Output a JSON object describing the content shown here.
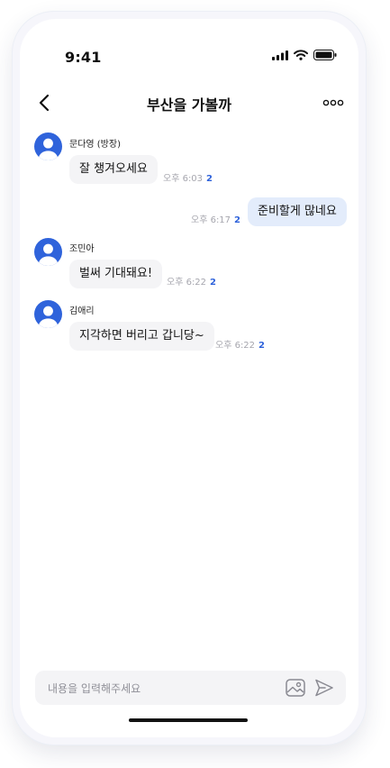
{
  "status_bar": {
    "time": "9:41"
  },
  "header": {
    "title": "부산을 가볼까"
  },
  "messages": [
    {
      "sender": "문다영 (방장)",
      "text": "잘 챙겨오세요",
      "time": "오후 6:03",
      "unread": "2"
    },
    {
      "sender": "",
      "text": "준비할게 많네요",
      "time": "오후 6:17",
      "unread": "2"
    },
    {
      "sender": "조민아",
      "text": "벌써 기대돼요!",
      "time": "오후 6:22",
      "unread": "2"
    },
    {
      "sender": "김애리",
      "text": "지각하면 버리고 갑니당~",
      "time": "오후 6:22",
      "unread": "2"
    }
  ],
  "composer": {
    "placeholder": "내용을 입력해주세요",
    "value": ""
  },
  "colors": {
    "accent": "#2f63db",
    "own_bubble": "#e3ecfb",
    "other_bubble": "#f4f4f6"
  }
}
